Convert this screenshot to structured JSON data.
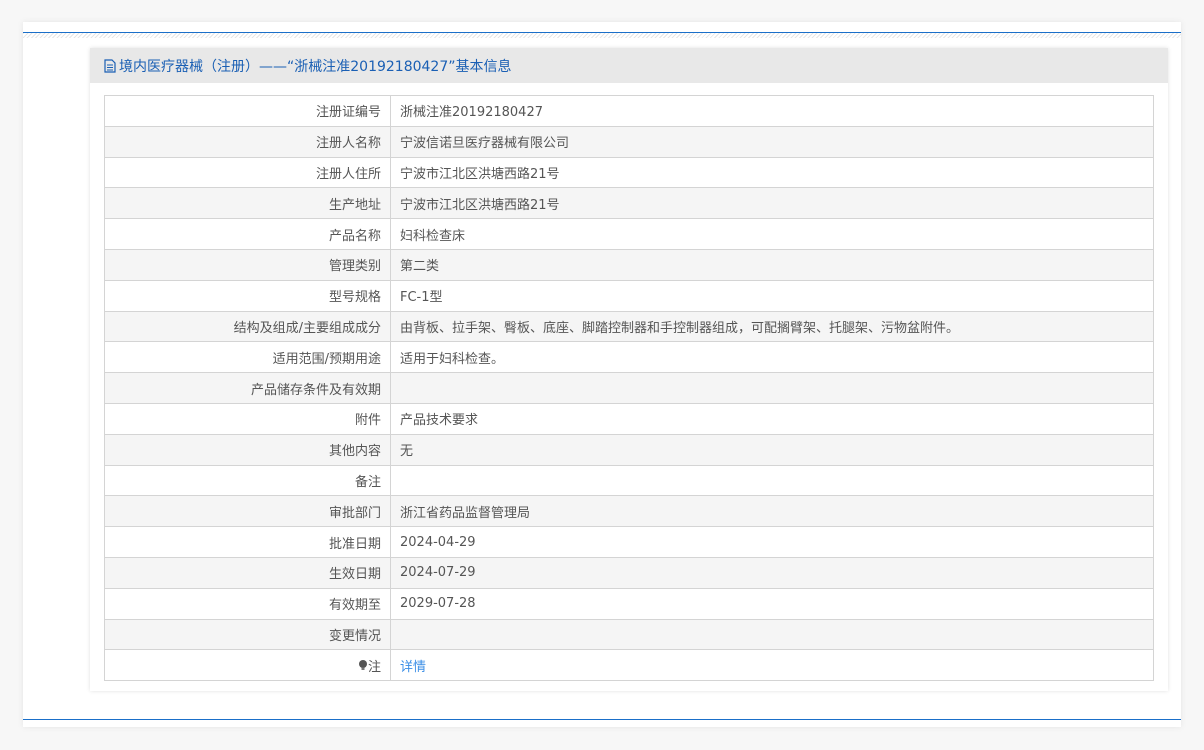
{
  "header": {
    "title": "境内医疗器械（注册）——“浙械注准20192180427”基本信息",
    "icon": "document-icon"
  },
  "rows": [
    {
      "label": "注册证编号",
      "value": "浙械注准20192180427"
    },
    {
      "label": "注册人名称",
      "value": "宁波信诺旦医疗器械有限公司"
    },
    {
      "label": "注册人住所",
      "value": "宁波市江北区洪塘西路21号"
    },
    {
      "label": "生产地址",
      "value": "宁波市江北区洪塘西路21号"
    },
    {
      "label": "产品名称",
      "value": "妇科检查床"
    },
    {
      "label": "管理类别",
      "value": "第二类"
    },
    {
      "label": "型号规格",
      "value": "FC-1型"
    },
    {
      "label": "结构及组成/主要组成成分",
      "value": "由背板、拉手架、臀板、底座、脚踏控制器和手控制器组成，可配搁臂架、托腿架、污物盆附件。"
    },
    {
      "label": "适用范围/预期用途",
      "value": "适用于妇科检查。"
    },
    {
      "label": "产品储存条件及有效期",
      "value": ""
    },
    {
      "label": "附件",
      "value": "产品技术要求"
    },
    {
      "label": "其他内容",
      "value": "无"
    },
    {
      "label": "备注",
      "value": ""
    },
    {
      "label": "审批部门",
      "value": "浙江省药品监督管理局"
    },
    {
      "label": "批准日期",
      "value": "2024-04-29"
    },
    {
      "label": "生效日期",
      "value": "2024-07-29"
    },
    {
      "label": "有效期至",
      "value": "2029-07-28"
    },
    {
      "label": "变更情况",
      "value": ""
    }
  ],
  "note": {
    "label": "注",
    "link": "详情",
    "icon": "bulb-icon"
  }
}
